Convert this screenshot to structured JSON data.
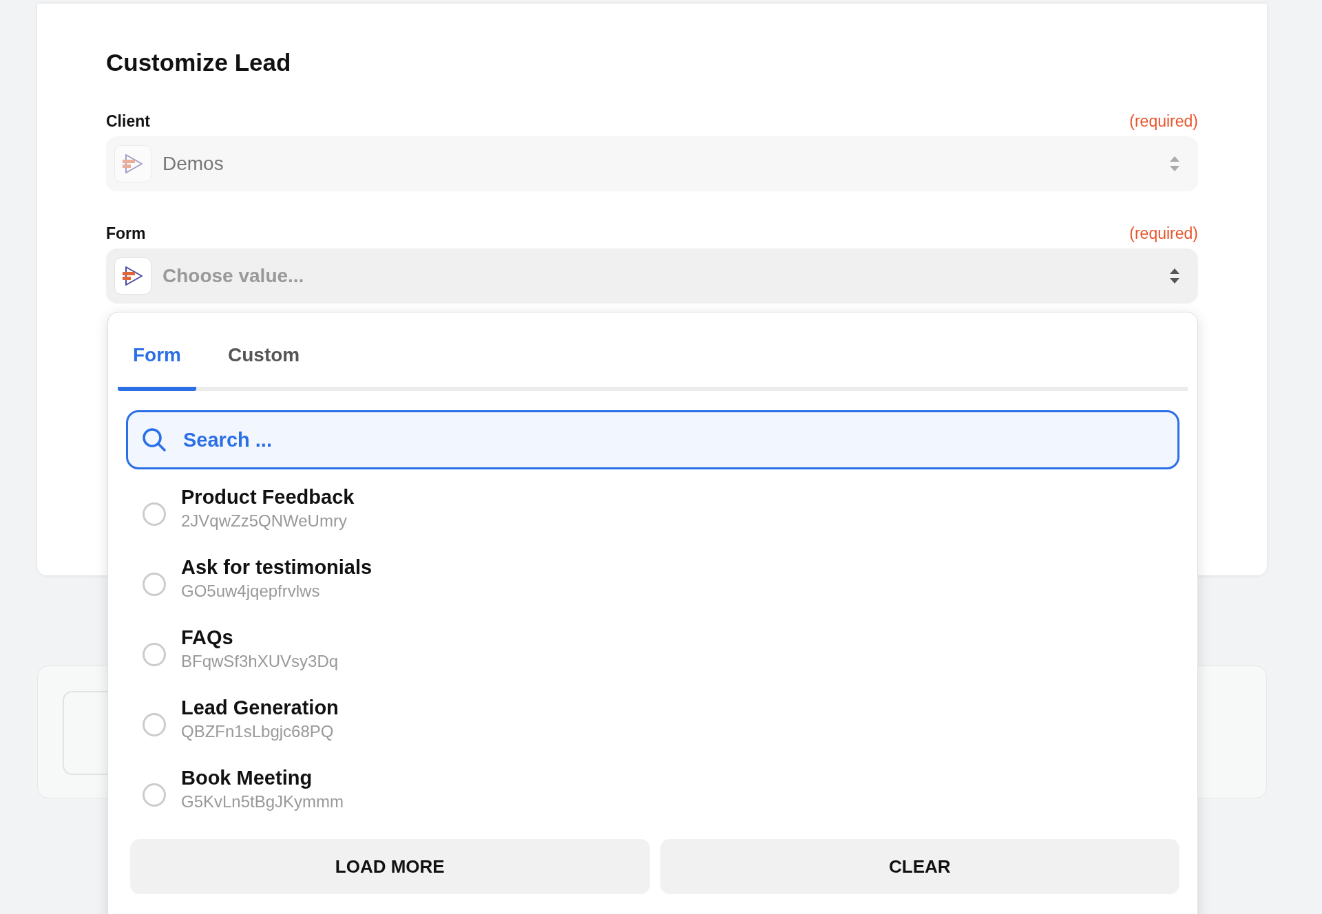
{
  "title": "Customize Lead",
  "fields": [
    {
      "label": "Client",
      "note": "(required)",
      "value": "Demos",
      "expanded": false
    },
    {
      "label": "Form",
      "note": "(required)",
      "placeholder": "Choose value...",
      "expanded": true
    }
  ],
  "dropdown": {
    "tabs": [
      {
        "label": "Form",
        "selected": true
      },
      {
        "label": "Custom",
        "selected": false
      }
    ],
    "search": {
      "placeholder": "Search ..."
    },
    "options": [
      {
        "name": "Product Feedback",
        "id": "2JVqwZz5QNWeUmry",
        "selected": false
      },
      {
        "name": "Ask for testimonials",
        "id": "GO5uw4jqepfrvlws",
        "selected": false
      },
      {
        "name": "FAQs",
        "id": "BFqwSf3hXUVsy3Dq",
        "selected": false
      },
      {
        "name": "Lead Generation",
        "id": "QBZFn1sLbgjc68PQ",
        "selected": false
      },
      {
        "name": "Book Meeting",
        "id": "G5KvLn5tBgJKymmm",
        "selected": false
      }
    ],
    "buttons": [
      "LOAD MORE",
      "CLEAR"
    ]
  }
}
